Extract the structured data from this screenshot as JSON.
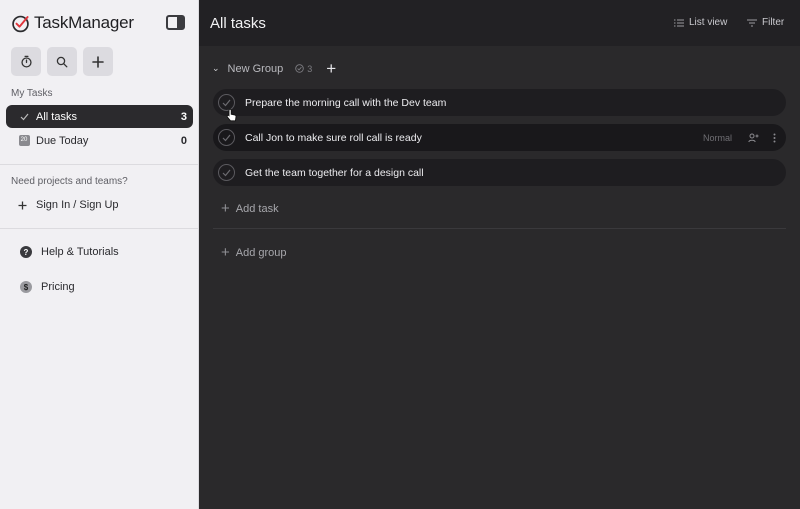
{
  "app": {
    "name": "TaskManager"
  },
  "sidebar": {
    "section_my_tasks": "My Tasks",
    "items": [
      {
        "label": "All tasks",
        "count": "3"
      },
      {
        "label": "Due Today",
        "count": "0",
        "date_badge": "20"
      }
    ],
    "prompt": "Need projects and teams?",
    "sign_in": "Sign In / Sign Up",
    "help": "Help & Tutorials",
    "pricing": "Pricing"
  },
  "main": {
    "title": "All tasks",
    "list_view": "List view",
    "filter": "Filter",
    "group": {
      "name": "New Group",
      "count": "3"
    },
    "tasks": [
      {
        "label": "Prepare the morning call with the Dev team"
      },
      {
        "label": "Call Jon to make sure roll call is ready",
        "priority": "Normal"
      },
      {
        "label": "Get the team together for a design call"
      }
    ],
    "add_task": "Add task",
    "add_group": "Add group"
  },
  "colors": {
    "sidebar_bg": "#f1f0f3",
    "main_bg": "#2a292b",
    "accent": "#e0353b"
  },
  "icons": [
    "logo-check-icon",
    "sidebar-toggle-icon",
    "timer-icon",
    "search-icon",
    "plus-icon",
    "check-icon",
    "calendar-icon",
    "help-icon",
    "dollar-icon",
    "list-icon",
    "filter-icon",
    "chevron-down-icon",
    "assign-icon",
    "more-icon"
  ]
}
